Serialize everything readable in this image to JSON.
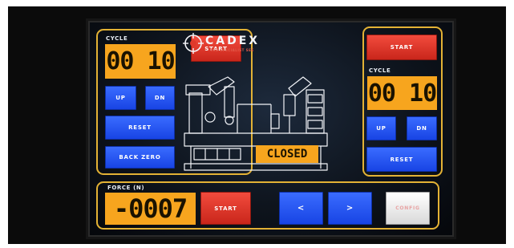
{
  "brand": {
    "name": "CADEX",
    "tagline": "THE SPECIALIST SEE"
  },
  "left_cycle": {
    "label": "CYCLE",
    "value": "00 10",
    "start_label": "START",
    "up_label": "UP",
    "down_label": "DN",
    "reset_label": "RESET",
    "back_zero_label": "BACK ZERO"
  },
  "right_cycle": {
    "label": "CYCLE",
    "value": "00 10",
    "start_label": "START",
    "up_label": "UP",
    "down_label": "DN",
    "reset_label": "RESET"
  },
  "machine": {
    "status": "CLOSED"
  },
  "force": {
    "label": "FORCE (N)",
    "value": "-0007",
    "start_label": "START",
    "prev_label": "<",
    "next_label": ">",
    "config_label": "CONFIG"
  },
  "colors": {
    "display_amber": "#f7a51e",
    "button_blue": "#1844e4",
    "button_red": "#c9261b",
    "panel_border": "#e3b235"
  }
}
